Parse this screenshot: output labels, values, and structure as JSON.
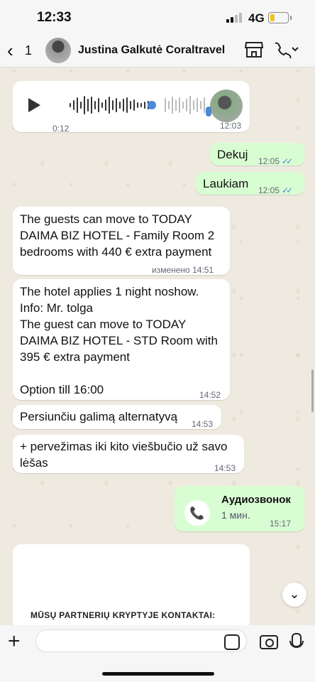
{
  "status": {
    "time": "12:33",
    "network": "4G"
  },
  "header": {
    "back_count": "1",
    "contact_name": "Justina Galkutė Coraltravel"
  },
  "voice_message": {
    "duration": "0:12",
    "time": "12:03"
  },
  "messages": [
    {
      "text": "Dekuj",
      "time": "12:05"
    },
    {
      "text": "Laukiam",
      "time": "12:05"
    },
    {
      "text": "The guests can move to TODAY\nDAIMA BIZ HOTEL - Family Room 2\nbedrooms with 440 € extra payment",
      "time": "изменено 14:51"
    },
    {
      "text": "The hotel applies 1 night noshow.\nInfo: Mr. tolga\nThe guest can move to TODAY\nDAIMA BIZ HOTEL - STD Room with\n395 € extra payment\n\nOption till 16:00",
      "time": "14:52"
    },
    {
      "text": "Persiunčiu galimą alternatyvą",
      "time": "14:53"
    },
    {
      "text": "+ pervežimas iki kito viešbučio už savo\nlėšas",
      "time": "14:53"
    }
  ],
  "call": {
    "title": "Аудиозвонок",
    "duration": "1 мин.",
    "time": "15:17"
  },
  "card": {
    "text": "MŪSŲ PARTNERIŲ KRYPTYJE KONTAKTAI:"
  },
  "icons": {
    "back": "chevron-left-icon",
    "store": "store-icon",
    "phone": "phone-icon",
    "play": "play-icon",
    "mic": "microphone-icon",
    "call": "outgoing-call-icon",
    "plus": "plus-icon",
    "sticker": "sticker-icon",
    "camera": "camera-icon"
  },
  "colors": {
    "outgoing_bubble": "#d9fdd3",
    "incoming_bubble": "#ffffff",
    "read_ticks": "#4a8ad8"
  }
}
